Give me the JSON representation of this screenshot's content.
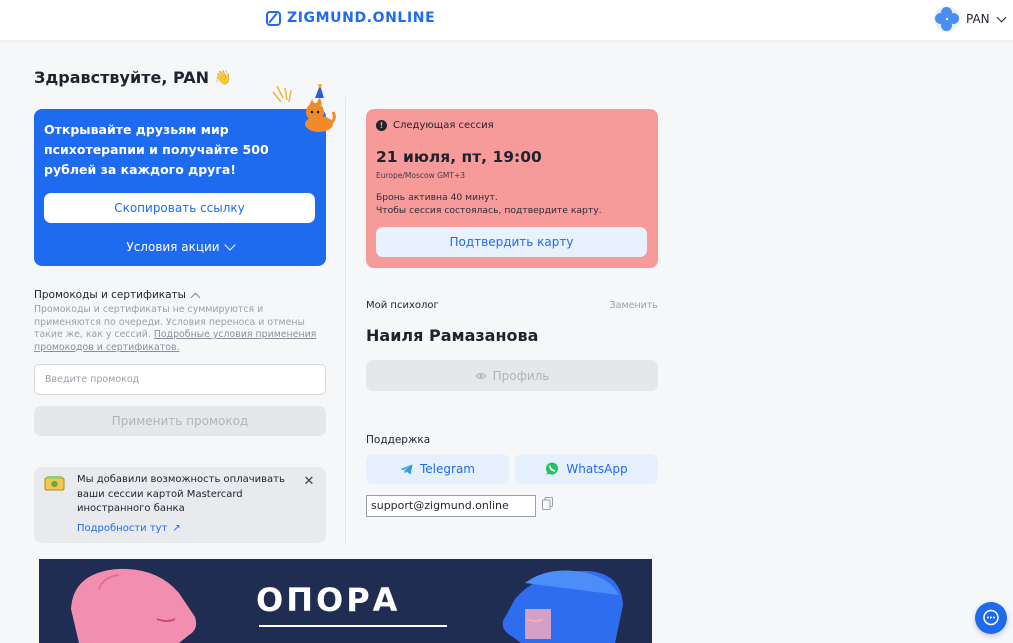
{
  "header": {
    "logo_text": "ZIGMUND.ONLINE",
    "user_name": "PAN"
  },
  "greeting": {
    "text": "Здравствуйте, PAN",
    "emoji": "👋"
  },
  "referral": {
    "text": "Открывайте друзьям мир психотерапии и получайте 500 рублей за каждого друга!",
    "copy_button": "Скопировать ссылку",
    "terms_label": "Условия акции"
  },
  "promo": {
    "title": "Промокоды и сертификаты",
    "description": "Промокоды и сертификаты не суммируются и применяются по очереди. Условия переноса и отмены такие же, как у сессий.",
    "link_text": "Подробные условия применения промокодов и сертификатов.",
    "input_placeholder": "Введите промокод",
    "apply_button": "Применить промокод"
  },
  "notice": {
    "text": "Мы добавили возможность оплачивать ваши сессии картой Mastercard иностранного банка",
    "link": "Подробности тут",
    "link_arrow": "↗",
    "close": "✕"
  },
  "session": {
    "heading": "Следующая сессия",
    "date": "21 июля, пт, 19:00",
    "timezone": "Europe/Moscow GMT+3",
    "note_line1": "Бронь активна 40 минут.",
    "note_line2": "Чтобы сессия состоялась, подтвердите карту.",
    "confirm_button": "Подтвердить карту",
    "warn_mark": "!"
  },
  "psychologist": {
    "label": "Мой психолог",
    "change": "Заменить",
    "name": "Наиля Рамазанова",
    "profile_button": "Профиль"
  },
  "support": {
    "label": "Поддержка",
    "telegram": "Telegram",
    "whatsapp": "WhatsApp",
    "email": "support@zigmund.online"
  },
  "banner": {
    "title": "ОПОРА"
  },
  "colors": {
    "brand_blue": "#1f6bf0",
    "session_pink": "#f79a9a",
    "banner_navy": "#1f2d52"
  },
  "icons": [
    "logo-mark-icon",
    "chevron-down-icon",
    "wave-hand-icon",
    "cat-party-icon",
    "chevron-up-icon",
    "money-icon",
    "close-icon",
    "external-link-icon",
    "warning-icon",
    "eye-icon",
    "telegram-icon",
    "whatsapp-icon",
    "copy-icon",
    "chat-icon"
  ]
}
